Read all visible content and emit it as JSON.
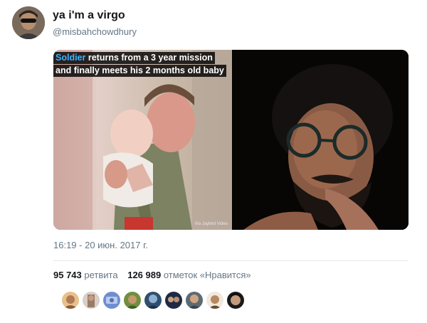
{
  "user": {
    "display_name": "ya i'm a virgo",
    "username": "@misbahchowdhury"
  },
  "media": {
    "caption_highlight": "Soldier",
    "caption_rest": " returns from a 3 year mission",
    "caption_line2": "and finally meets his 2 months old baby",
    "watermark": "Via Jaybird Video"
  },
  "tweet": {
    "timestamp": "16:19 - 20 июн. 2017 г."
  },
  "stats": {
    "retweets_count": "95 743",
    "retweets_label": "ретвита",
    "likes_count": "126 989",
    "likes_label": "отметок «Нравится»"
  },
  "colors": {
    "accent": "#3db4ff",
    "secondary_text": "#657786",
    "divider": "#e6ecf0"
  }
}
